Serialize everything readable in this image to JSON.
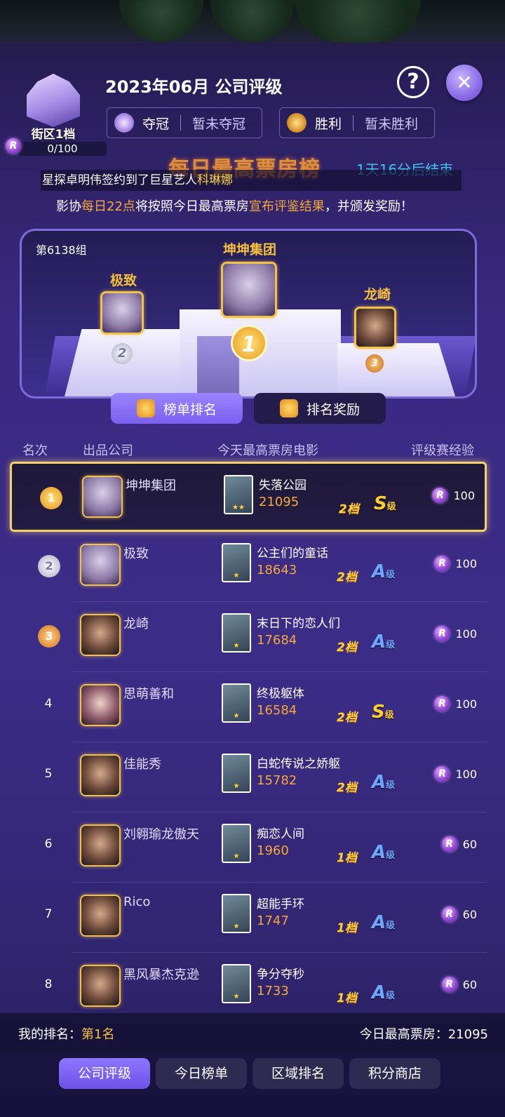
{
  "header": {
    "title": "2023年06月 公司评级",
    "district": {
      "label": "街区1档",
      "progress": "0/100",
      "currency_icon": "R"
    },
    "help_label": "?",
    "close_label": "✕",
    "stats": [
      {
        "icon": "crown-icon",
        "label": "夺冠",
        "value": "暂未夺冠"
      },
      {
        "icon": "trophy-icon",
        "label": "胜利",
        "value": "暂未胜利"
      }
    ]
  },
  "banner": {
    "title": "每日最高票房榜",
    "timer": "1天16分后结束",
    "ticker_prefix": "星探卓明伟签约到了巨星艺人",
    "ticker_highlight": "科琳娜",
    "notice_parts": [
      "影协",
      "每日22点",
      "将按照今日最高票房",
      "宣布评鉴结果",
      "，并颁发奖励！"
    ]
  },
  "podium": {
    "group": "第6138组",
    "first": {
      "name": "坤坤集团",
      "medal": "1"
    },
    "second": {
      "name": "极致",
      "medal": "2"
    },
    "third": {
      "name": "龙崎",
      "medal": "3"
    }
  },
  "tabs": [
    {
      "label": "榜单排名",
      "active": true
    },
    {
      "label": "排名奖励",
      "active": false
    }
  ],
  "list": {
    "headers": {
      "rank": "名次",
      "company": "出品公司",
      "movie": "今天最高票房电影",
      "exp": "评级赛经验"
    },
    "rows": [
      {
        "rank": "1",
        "company": "坤坤集团",
        "movie": "失落公园",
        "box": "21095",
        "tier": "2档",
        "grade": "S",
        "grade_suffix": "级",
        "exp": "100",
        "stars": "★★",
        "avatar": "hamster"
      },
      {
        "rank": "2",
        "company": "极致",
        "movie": "公主们的童话",
        "box": "18643",
        "tier": "2档",
        "grade": "A",
        "grade_suffix": "级",
        "exp": "100",
        "stars": "★",
        "avatar": "hamster"
      },
      {
        "rank": "3",
        "company": "龙崎",
        "movie": "末日下的恋人们",
        "box": "17684",
        "tier": "2档",
        "grade": "A",
        "grade_suffix": "级",
        "exp": "100",
        "stars": "★",
        "avatar": "male"
      },
      {
        "rank": "4",
        "company": "思萌善和",
        "movie": "终极躯体",
        "box": "16584",
        "tier": "2档",
        "grade": "S",
        "grade_suffix": "级",
        "exp": "100",
        "stars": "★",
        "avatar": "female"
      },
      {
        "rank": "5",
        "company": "佳能秀",
        "movie": "白蛇传说之娇躯",
        "box": "15782",
        "tier": "2档",
        "grade": "A",
        "grade_suffix": "级",
        "exp": "100",
        "stars": "★",
        "avatar": "male"
      },
      {
        "rank": "6",
        "company": "刘翱瑜龙傲天",
        "movie": "痴恋人间",
        "box": "1960",
        "tier": "1档",
        "grade": "A",
        "grade_suffix": "级",
        "exp": "60",
        "stars": "★",
        "avatar": "male"
      },
      {
        "rank": "7",
        "company": "Rico",
        "movie": "超能手环",
        "box": "1747",
        "tier": "1档",
        "grade": "A",
        "grade_suffix": "级",
        "exp": "60",
        "stars": "★",
        "avatar": "male"
      },
      {
        "rank": "8",
        "company": "黑风暴杰克逊",
        "movie": "争分夺秒",
        "box": "1733",
        "tier": "1档",
        "grade": "A",
        "grade_suffix": "级",
        "exp": "60",
        "stars": "★",
        "avatar": "male"
      }
    ]
  },
  "my_rank": {
    "label": "我的排名：",
    "value": "第1名",
    "box_label": "今日最高票房：",
    "box_value": "21095"
  },
  "nav": [
    {
      "label": "公司评级",
      "active": true
    },
    {
      "label": "今日榜单",
      "active": false
    },
    {
      "label": "区域排名",
      "active": false
    },
    {
      "label": "积分商店",
      "active": false
    }
  ],
  "colors": {
    "accent": "#f6a83a",
    "highlight": "#f4d24a",
    "timer": "#39c8f0",
    "gold": "#f2d36a"
  }
}
